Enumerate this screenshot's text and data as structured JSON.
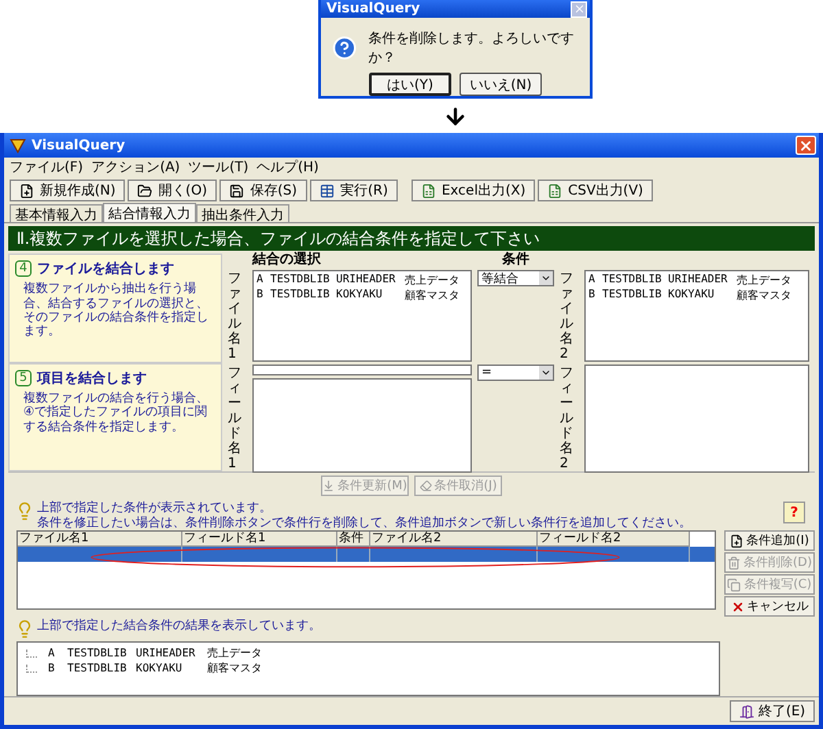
{
  "dialog": {
    "title": "VisualQuery",
    "message": "条件を削除します。よろしいですか？",
    "buttons": [
      {
        "label": "はい(Y)",
        "default": true
      },
      {
        "label": "いいえ(N)",
        "default": false
      }
    ]
  },
  "window": {
    "title": "VisualQuery"
  },
  "menu": [
    "ファイル(F)",
    "アクション(A)",
    "ツール(T)",
    "ヘルプ(H)"
  ],
  "toolbar": [
    {
      "label": "新規作成(N)",
      "kind": "new"
    },
    {
      "label": "開く(O)",
      "kind": "open"
    },
    {
      "label": "保存(S)",
      "kind": "save"
    },
    {
      "label": "実行(R)",
      "kind": "run"
    },
    {
      "label": "Excel出力(X)",
      "kind": "export"
    },
    {
      "label": "CSV出力(V)",
      "kind": "export"
    }
  ],
  "tabs": [
    {
      "label": "基本情報入力",
      "selected": false
    },
    {
      "label": "結合情報入力",
      "selected": true
    },
    {
      "label": "抽出条件入力",
      "selected": false
    }
  ],
  "header": "Ⅱ.複数ファイルを選択した場合、ファイルの結合条件を指定して下さい",
  "steps": [
    {
      "number": "4",
      "title": "ファイルを結合します",
      "text": "複数ファイルから抽出を行う場合、結合するファイルの選択と、そのファイルの結合条件を指定します。"
    },
    {
      "number": "5",
      "title": "項目を結合します",
      "text": "複数ファイルの結合を行う場合、④で指定したファイルの項目に関する結合条件を指定します。"
    }
  ],
  "join": {
    "title": "結合の選択",
    "condition_title": "条件",
    "file_label_1": "ファイル名1",
    "field_label_1": "フィールド名1",
    "file_label_2": "ファイル名2",
    "field_label_2": "フィールド名2",
    "join_type": "等結合",
    "operator": "=",
    "files_1": [
      [
        "A",
        "TESTDBLIB",
        "URIHEADER",
        "売上データ"
      ],
      [
        "B",
        "TESTDBLIB",
        "KOKYAKU",
        "顧客マスタ"
      ]
    ],
    "files_2": [
      [
        "A",
        "TESTDBLIB",
        "URIHEADER",
        "売上データ"
      ],
      [
        "B",
        "TESTDBLIB",
        "KOKYAKU",
        "顧客マスタ"
      ]
    ]
  },
  "actions": [
    {
      "label": "条件更新(M)",
      "disabled": true
    },
    {
      "label": "条件取消(J)",
      "disabled": true
    }
  ],
  "info": [
    "上部で指定した条件が表示されています。",
    "条件を修正したい場合は、条件削除ボタンで条件行を削除して、条件追加ボタンで新しい条件行を追加してください。"
  ],
  "help": "?",
  "grid": {
    "columns": [
      "ファイル名1",
      "フィールド名1",
      "条件",
      "ファイル名2",
      "フィールド名2"
    ],
    "rows": [
      {
        "selected": true
      }
    ]
  },
  "side_buttons": [
    {
      "label": "条件追加(I)",
      "kind": "new",
      "disabled": false
    },
    {
      "label": "条件削除(D)",
      "kind": "delete",
      "disabled": true
    },
    {
      "label": "条件複写(C)",
      "kind": "copy",
      "disabled": true
    },
    {
      "label": "キャンセル",
      "kind": "cancel",
      "disabled": false
    }
  ],
  "result_info": "上部で指定した結合条件の結果を表示しています。",
  "result_tree": [
    [
      "A",
      "TESTDBLIB",
      "URIHEADER",
      "売上データ"
    ],
    [
      "B",
      "TESTDBLIB",
      "KOKYAKU",
      "顧客マスタ"
    ]
  ],
  "exit": "終了(E)"
}
